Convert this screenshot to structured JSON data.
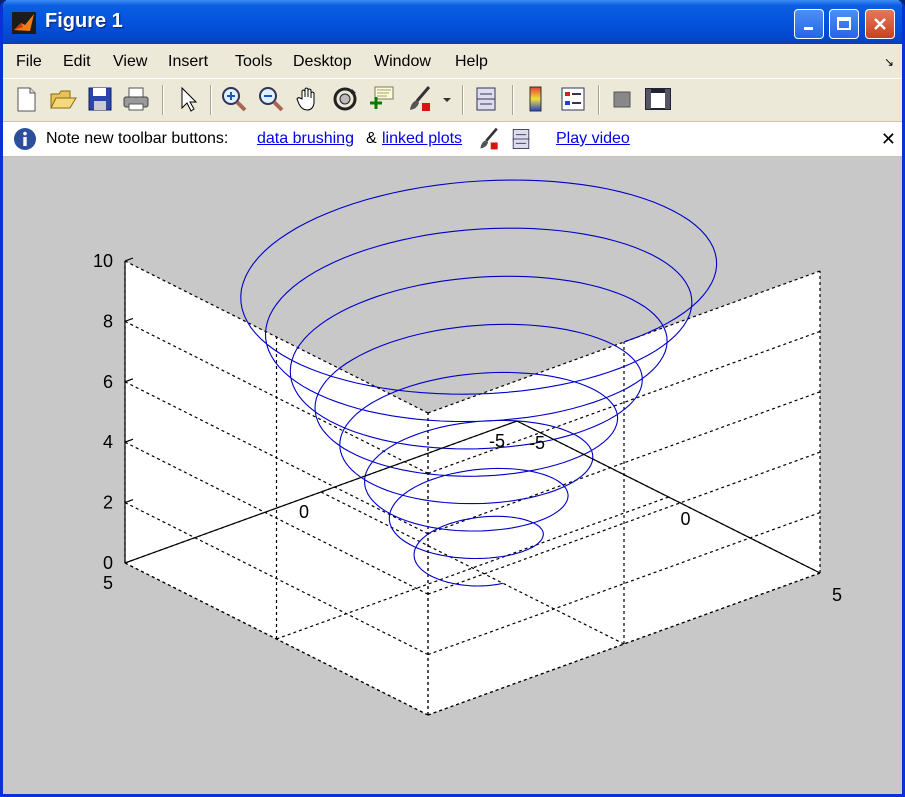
{
  "window": {
    "title": "Figure 1"
  },
  "menu": {
    "items": [
      "File",
      "Edit",
      "View",
      "Insert",
      "Tools",
      "Desktop",
      "Window",
      "Help"
    ]
  },
  "infobar": {
    "note": "Note new toolbar buttons:",
    "link_brushing": "data brushing",
    "amp": "&",
    "link_linked": "linked plots",
    "link_video": "Play video"
  },
  "toolbar": {
    "icons": [
      "new-file-icon",
      "open-folder-icon",
      "save-icon",
      "print-icon",
      "pointer-icon",
      "zoom-in-icon",
      "zoom-out-icon",
      "pan-hand-icon",
      "rotate-3d-icon",
      "data-cursor-icon",
      "brush-icon",
      "link-plot-icon",
      "colorbar-icon",
      "legend-icon",
      "hide-plot-tools-icon",
      "show-plot-tools-icon"
    ]
  },
  "colors": {
    "curve": "#0000c8",
    "title_bar": "#0553dd",
    "figure_bg": "#c8c8c8",
    "axes_bg": "#ffffff"
  },
  "chart_data": {
    "type": "line",
    "title": "",
    "xlabel": "",
    "ylabel": "",
    "zlabel": "",
    "xlim": [
      -5,
      5
    ],
    "ylim": [
      -5,
      5
    ],
    "zlim": [
      0,
      10
    ],
    "x_ticks": [
      "-5",
      "0",
      "5"
    ],
    "y_ticks": [
      "-5",
      "0",
      "5"
    ],
    "z_ticks": [
      "0",
      "2",
      "4",
      "6",
      "8",
      "10"
    ],
    "grid": true,
    "view": "3d",
    "series": [
      {
        "curve": "conical helix",
        "x": "r*cos(t)",
        "y": "r*sin(t)",
        "z_range": [
          0,
          10
        ],
        "radius_start": 1,
        "radius_end": 5,
        "turns": 8
      }
    ]
  }
}
